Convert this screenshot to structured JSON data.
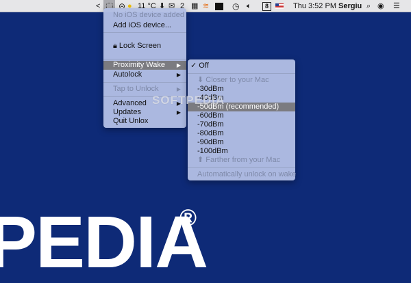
{
  "background": {
    "logo_text": "PEDIA",
    "logo_mark": "®",
    "watermark": "SOFTPEDIA"
  },
  "menubar": {
    "chevron": "<",
    "weather": "11 °C",
    "mail_count": "2",
    "keyboard": "8",
    "clock": "Thu 3:52 PM",
    "user": "Sergiu"
  },
  "main_menu": {
    "items": [
      "No iOS device added",
      "Add iOS device...",
      "Lock Screen",
      "Proximity Wake",
      "Autolock",
      "Tap to Unlock",
      "Advanced",
      "Updates",
      "Quit Unlox"
    ]
  },
  "submenu": {
    "off": "Off",
    "check": "✓",
    "closer": "Closer to your Mac",
    "levels": [
      "-30dBm",
      "-40dBm",
      "-50dBm (recommended)",
      "-60dBm",
      "-70dBm",
      "-80dBm",
      "-90dBm",
      "-100dBm"
    ],
    "farther": "Farther from your Mac",
    "auto": "Automatically unlock on wake"
  }
}
